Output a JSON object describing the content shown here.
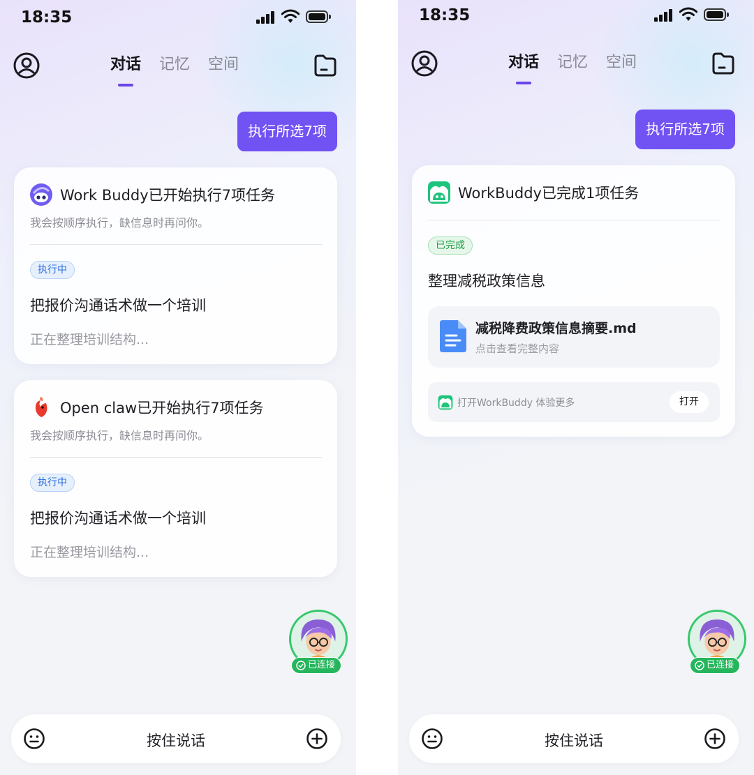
{
  "status_bar": {
    "time": "18:35"
  },
  "nav": {
    "tabs": [
      "对话",
      "记忆",
      "空间"
    ],
    "active_tab": 0
  },
  "execute_bubble": "执行所选7项",
  "left_screen": {
    "cards": [
      {
        "agent_logo_icon": "workbuddy-purple-robot-icon",
        "title": "Work Buddy已开始执行7项任务",
        "subtitle": "我会按顺序执行，缺信息时再问你。",
        "status": "执行中",
        "task": "把报价沟通话术做一个培训",
        "progress": "正在整理培训结构..."
      },
      {
        "agent_logo_icon": "openclaw-red-claw-icon",
        "title": "Open claw已开始执行7项任务",
        "subtitle": "我会按顺序执行，缺信息时再问你。",
        "status": "执行中",
        "task": "把报价沟通话术做一个培训",
        "progress": "正在整理培训结构..."
      }
    ]
  },
  "right_screen": {
    "card": {
      "agent_logo_icon": "workbuddy-green-logo-icon",
      "title": "WorkBuddy已完成1项任务",
      "status": "已完成",
      "task": "整理减税政策信息",
      "file": {
        "name": "减税降费政策信息摘要.md",
        "hint": "点击查看完整内容"
      },
      "promo": {
        "text": "打开WorkBuddy 体验更多",
        "button": "打开"
      }
    }
  },
  "assistant": {
    "status": "已连接"
  },
  "bottom_bar": {
    "label": "按住说话"
  },
  "colors": {
    "accent": "#7152f3",
    "tab_indicator": "#6b44e8",
    "running_pill": "#2f6fe0",
    "done_pill": "#1e9c45",
    "connected_green": "#25b65c"
  }
}
